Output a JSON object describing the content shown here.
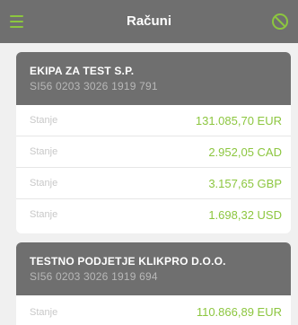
{
  "header": {
    "title": "Računi",
    "menu_icon": "hamburger-menu-icon",
    "right_icon": "ban-icon",
    "accent_color": "#8cc63f",
    "bar_color": "#6f6f6f"
  },
  "accounts": [
    {
      "name": "EKIPA ZA TEST S.P.",
      "iban": "SI56 0203 3026 1919 791",
      "balances": [
        {
          "label": "Stanje",
          "amount": "131.085,70 EUR"
        },
        {
          "label": "Stanje",
          "amount": "2.952,05 CAD"
        },
        {
          "label": "Stanje",
          "amount": "3.157,65 GBP"
        },
        {
          "label": "Stanje",
          "amount": "1.698,32 USD"
        }
      ]
    },
    {
      "name": "TESTNO PODJETJE KLIKPRO D.O.O.",
      "iban": "SI56 0203 3026 1919 694",
      "balances": [
        {
          "label": "Stanje",
          "amount": "110.866,89 EUR"
        }
      ]
    }
  ]
}
